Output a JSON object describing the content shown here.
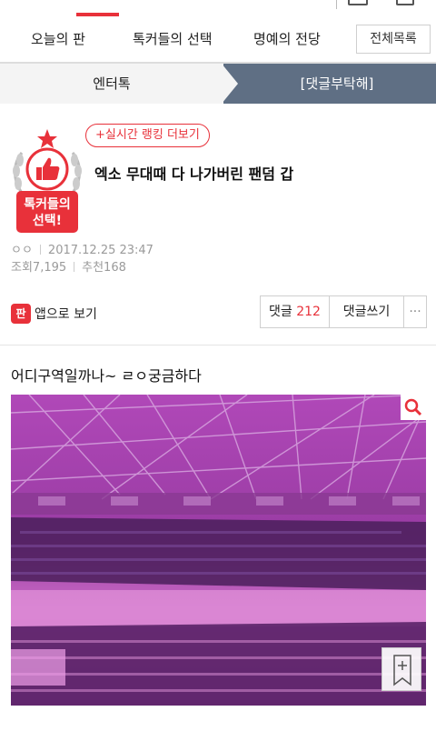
{
  "nav": {
    "items": [
      "오늘의 판",
      "톡커들의 선택",
      "명예의 전당"
    ],
    "all_button": "전체목록"
  },
  "category": {
    "left": "엔터톡",
    "right": "[댓글부탁해]"
  },
  "badge": {
    "line1": "톡커들의",
    "line2": "선택!"
  },
  "post": {
    "rank_link": "+실시간 랭킹 더보기",
    "title": "엑소 무대때 다 나가버린 팬덤 갑",
    "author": "ㅇㅇ",
    "date": "2017.12.25 23:47",
    "views": "조회7,195",
    "recommends": "추천168"
  },
  "actions": {
    "app_icon": "판",
    "app_view": "앱으로 보기",
    "comment_label": "댓글",
    "comment_count": "212",
    "write_comment": "댓글쓰기",
    "more": "···"
  },
  "content": {
    "text": "어디구역일까나~ ㄹㅇ궁금하다"
  },
  "colors": {
    "accent": "#e8313a",
    "category_active": "#5f6f84",
    "photo_tint": "#b040b0"
  },
  "icons": {
    "zoom": "search-icon",
    "bookmark": "bookmark-add-icon",
    "badge": "thumbs-up-icon"
  }
}
